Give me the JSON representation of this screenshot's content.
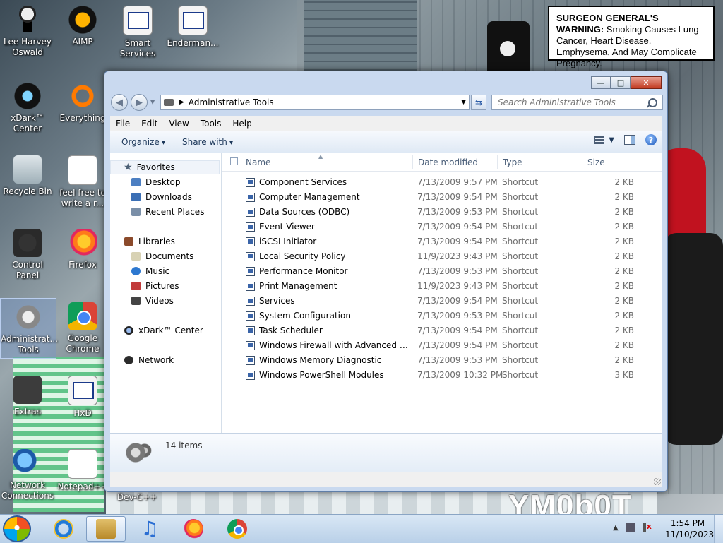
{
  "warning": {
    "lead": "SURGEON GENERAL'S WARNING:",
    "text": " Smoking Causes Lung Cancer, Heart Disease, Emphysema, And May Complicate Pregnancy."
  },
  "wallpaper": {
    "title": "YM0b0T"
  },
  "desktop_icons": [
    {
      "label": "Lee Harvey Oswald",
      "icon": "doll-icon"
    },
    {
      "label": "AIMP",
      "icon": "aimp-icon"
    },
    {
      "label": "Smart Services",
      "icon": "shortcut-icon"
    },
    {
      "label": "Enderman...",
      "icon": "shortcut-icon"
    },
    {
      "label": "xDark™ Center",
      "icon": "xdark-icon"
    },
    {
      "label": "Everything",
      "icon": "everything-icon"
    },
    {
      "label": "Recycle Bin",
      "icon": "recycle-bin-icon"
    },
    {
      "label": "feel free to write a r...",
      "icon": "text-file-icon"
    },
    {
      "label": "Control Panel",
      "icon": "control-panel-icon"
    },
    {
      "label": "Firefox",
      "icon": "firefox-icon"
    },
    {
      "label": "Administrat... Tools",
      "icon": "admin-tools-icon"
    },
    {
      "label": "Google Chrome",
      "icon": "chrome-icon"
    },
    {
      "label": "Extras",
      "icon": "extras-icon"
    },
    {
      "label": "HxD",
      "icon": "shortcut-icon"
    },
    {
      "label": "Network Connections",
      "icon": "network-icon"
    },
    {
      "label": "Notepad++",
      "icon": "notepad-icon"
    },
    {
      "label": "Dev-C++",
      "icon": "devcpp-icon"
    }
  ],
  "explorer": {
    "address": "Administrative Tools",
    "search_placeholder": "Search Administrative Tools",
    "menu": [
      "File",
      "Edit",
      "View",
      "Tools",
      "Help"
    ],
    "toolbar": {
      "organize": "Organize",
      "share": "Share with"
    },
    "nav": {
      "favorites": "Favorites",
      "desktop": "Desktop",
      "downloads": "Downloads",
      "recent": "Recent Places",
      "libraries": "Libraries",
      "documents": "Documents",
      "music": "Music",
      "pictures": "Pictures",
      "videos": "Videos",
      "xdark": "xDark™ Center",
      "network": "Network"
    },
    "columns": {
      "name": "Name",
      "date": "Date modified",
      "type": "Type",
      "size": "Size"
    },
    "files": [
      {
        "name": "Component Services",
        "date": "7/13/2009 9:57 PM",
        "type": "Shortcut",
        "size": "2 KB"
      },
      {
        "name": "Computer Management",
        "date": "7/13/2009 9:54 PM",
        "type": "Shortcut",
        "size": "2 KB"
      },
      {
        "name": "Data Sources (ODBC)",
        "date": "7/13/2009 9:53 PM",
        "type": "Shortcut",
        "size": "2 KB"
      },
      {
        "name": "Event Viewer",
        "date": "7/13/2009 9:54 PM",
        "type": "Shortcut",
        "size": "2 KB"
      },
      {
        "name": "iSCSI Initiator",
        "date": "7/13/2009 9:54 PM",
        "type": "Shortcut",
        "size": "2 KB"
      },
      {
        "name": "Local Security Policy",
        "date": "11/9/2023 9:43 PM",
        "type": "Shortcut",
        "size": "2 KB"
      },
      {
        "name": "Performance Monitor",
        "date": "7/13/2009 9:53 PM",
        "type": "Shortcut",
        "size": "2 KB"
      },
      {
        "name": "Print Management",
        "date": "11/9/2023 9:43 PM",
        "type": "Shortcut",
        "size": "2 KB"
      },
      {
        "name": "Services",
        "date": "7/13/2009 9:54 PM",
        "type": "Shortcut",
        "size": "2 KB"
      },
      {
        "name": "System Configuration",
        "date": "7/13/2009 9:53 PM",
        "type": "Shortcut",
        "size": "2 KB"
      },
      {
        "name": "Task Scheduler",
        "date": "7/13/2009 9:54 PM",
        "type": "Shortcut",
        "size": "2 KB"
      },
      {
        "name": "Windows Firewall with Advanced Secu...",
        "date": "7/13/2009 9:54 PM",
        "type": "Shortcut",
        "size": "2 KB"
      },
      {
        "name": "Windows Memory Diagnostic",
        "date": "7/13/2009 9:53 PM",
        "type": "Shortcut",
        "size": "2 KB"
      },
      {
        "name": "Windows PowerShell Modules",
        "date": "7/13/2009 10:32 PM",
        "type": "Shortcut",
        "size": "3 KB"
      }
    ],
    "status": {
      "count": "14 items"
    }
  },
  "taskbar": {
    "time": "1:54 PM",
    "date": "11/10/2023"
  }
}
